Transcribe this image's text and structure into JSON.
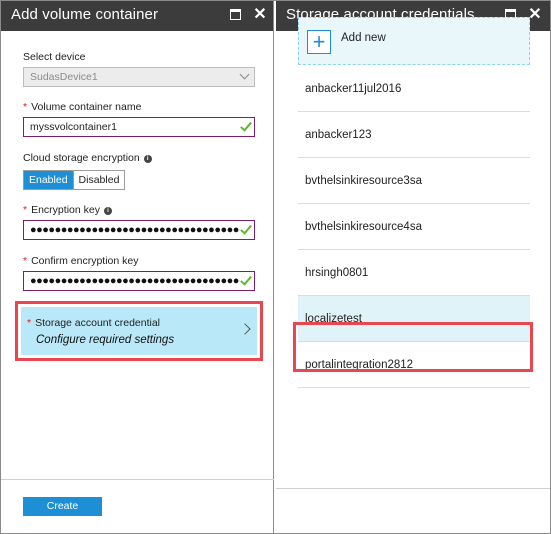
{
  "left_blade": {
    "title": "Add volume container",
    "select_device": {
      "label": "Select device",
      "value": "SudasDevice1"
    },
    "volume_name": {
      "label": "Volume container name",
      "value": "myssvolcontainer1"
    },
    "encryption": {
      "label": "Cloud storage encryption",
      "enabled_label": "Enabled",
      "disabled_label": "Disabled",
      "selected": "Enabled"
    },
    "encryption_key": {
      "label": "Encryption key",
      "masked": "●●●●●●●●●●●●●●●●●●●●●●●●●●●●●●●●●●●●●●●●"
    },
    "confirm_key": {
      "label": "Confirm encryption key",
      "masked": "●●●●●●●●●●●●●●●●●●●●●●●●●●●●●●●●●●●●●●●●"
    },
    "credential": {
      "label": "Storage account credential",
      "subtitle": "Configure required settings"
    },
    "create_label": "Create"
  },
  "right_blade": {
    "title": "Storage account credentials",
    "add_new_label": "Add new",
    "accounts": [
      "anbacker11jul2016",
      "anbacker123",
      "bvthelsinkiresource3sa",
      "bvthelsinkiresource4sa",
      "hrsingh0801",
      "localizetest",
      "portalintegration2812"
    ],
    "selected_account": "localizetest"
  },
  "colors": {
    "header_bg": "#3c3c3c",
    "accent_blue": "#1e8fd5",
    "highlight_red": "#e8474f",
    "tile_blue": "#b9e8f8",
    "valid_green": "#5cb832"
  },
  "icons": [
    "maximize-icon",
    "close-icon",
    "chevron-down-icon",
    "checkmark-icon",
    "info-icon",
    "chevron-right-icon",
    "plus-icon"
  ]
}
